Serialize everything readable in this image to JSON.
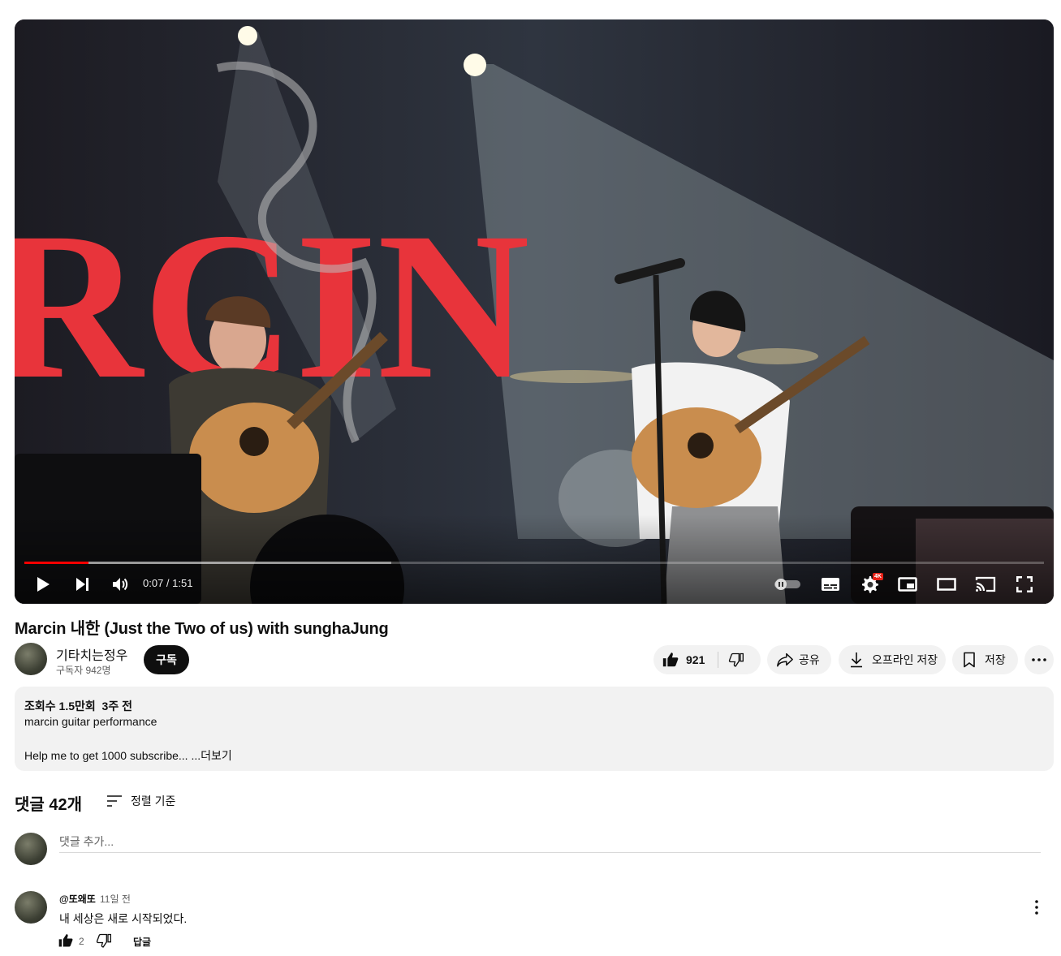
{
  "video": {
    "current_time": "0:07",
    "duration": "1:51",
    "time_separator": " / ",
    "played_fraction": 0.063,
    "buffered_fraction": 0.36,
    "quality_badge": "4K",
    "banner_text": "RCIN",
    "accent_color": "#ff0000"
  },
  "title": "Marcin 내한 (Just the Two of us) with sunghaJung",
  "channel": {
    "name": "기타치는정우",
    "subscribers": "구독자 942명",
    "subscribe_label": "구독"
  },
  "actions": {
    "like_count": "921",
    "share_label": "공유",
    "download_label": "오프라인 저장",
    "save_label": "저장"
  },
  "description": {
    "meta": "조회수 1.5만회  3주 전",
    "line1": "marcin guitar performance",
    "line2": "Help me to get 1000 subscribe...",
    "more_label": "...더보기"
  },
  "comments": {
    "count_label": "댓글 42개",
    "sort_label": "정렬 기준",
    "add_placeholder": "댓글 추가...",
    "items": [
      {
        "author": "@또왜또",
        "time": "11일 전",
        "text": "내 세상은 새로 시작되었다.",
        "likes": "2",
        "reply_label": "답글"
      }
    ]
  }
}
